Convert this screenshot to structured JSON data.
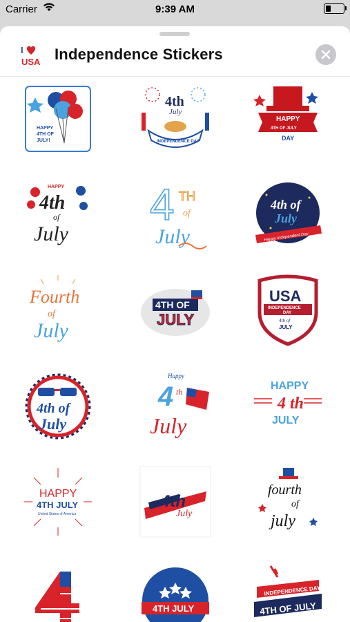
{
  "status_bar": {
    "carrier": "Carrier",
    "time": "9:39 AM",
    "battery_level": 0.3
  },
  "header": {
    "app_icon_label": "USA",
    "title": "Independence Stickers",
    "close_icon": "close-x-icon"
  },
  "colors": {
    "red": "#d8232a",
    "blue": "#1f4fa3",
    "navy": "#1c2a5e",
    "sky": "#4aa3df"
  },
  "stickers": [
    {
      "name": "balloons-happy-4th",
      "texts": [
        "HAPPY",
        "4TH OF",
        "JULY!"
      ]
    },
    {
      "name": "pie-4th-july",
      "texts": [
        "4th",
        "July",
        "INDEPENDENCE DAY"
      ]
    },
    {
      "name": "uncle-sam-hat-happy",
      "texts": [
        "HAPPY",
        "4TH OF JULY",
        "DAY"
      ]
    },
    {
      "name": "happy-4th-of-july-script",
      "texts": [
        "HAPPY",
        "4th",
        "of",
        "July"
      ]
    },
    {
      "name": "outline-4th-of-july",
      "texts": [
        "4",
        "TH",
        "of",
        "July"
      ]
    },
    {
      "name": "navy-circle-4th-july",
      "texts": [
        "4th of",
        "July",
        "Happy Independent Day"
      ]
    },
    {
      "name": "fourth-of-july-script",
      "texts": [
        "Fourth",
        "of",
        "July"
      ]
    },
    {
      "name": "4th-of-july-badge",
      "texts": [
        "4TH OF",
        "JULY"
      ]
    },
    {
      "name": "usa-shield",
      "texts": [
        "USA",
        "INDEPENDENCE",
        "DAY",
        "4th of",
        "JULY"
      ]
    },
    {
      "name": "sunglasses-4th-of-july",
      "texts": [
        "4th of",
        "July"
      ]
    },
    {
      "name": "happy-4th-july-flag",
      "texts": [
        "Happy",
        "4",
        "th",
        "July"
      ]
    },
    {
      "name": "happy-4th-july-lines",
      "texts": [
        "HAPPY",
        "4 th",
        "JULY"
      ]
    },
    {
      "name": "happy-4th-july-burst",
      "texts": [
        "HAPPY",
        "4TH JULY",
        "United States of America"
      ]
    },
    {
      "name": "brush-4th-july",
      "texts": [
        "4th",
        "July"
      ]
    },
    {
      "name": "fourth-of-july-hat",
      "texts": [
        "fourth",
        "of",
        "july"
      ]
    },
    {
      "name": "flag-4",
      "texts": [
        "4"
      ]
    },
    {
      "name": "4th-july-stars-badge",
      "texts": [
        "4TH JULY"
      ]
    },
    {
      "name": "independence-day-4th-july",
      "texts": [
        "INDEPENDENCE DAY",
        "4TH OF JULY"
      ]
    }
  ]
}
